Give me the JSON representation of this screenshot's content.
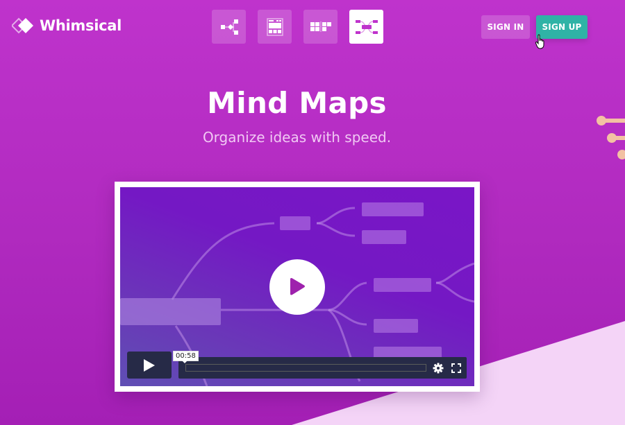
{
  "brand": {
    "name": "Whimsical"
  },
  "switcher": {
    "items": [
      {
        "name": "flowcharts",
        "icon": "flowchart-icon",
        "active": false
      },
      {
        "name": "wireframes",
        "icon": "wireframe-icon",
        "active": false
      },
      {
        "name": "sticky-notes",
        "icon": "sticky-notes-icon",
        "active": false
      },
      {
        "name": "mind-maps",
        "icon": "mind-map-icon",
        "active": true
      }
    ]
  },
  "auth": {
    "sign_in": "SIGN IN",
    "sign_up": "SIGN UP"
  },
  "hero": {
    "title": "Mind Maps",
    "subtitle": "Organize ideas with speed."
  },
  "video": {
    "time_tooltip": "00:58",
    "progress": 0,
    "controls": [
      "play-icon",
      "settings-icon",
      "fullscreen-icon"
    ]
  },
  "colors": {
    "background": "#bf33cc",
    "sign_up": "#2fb3a6",
    "video_controls": "#262a47",
    "accent_light": "#f4d4f7",
    "deco": "#f3c1a3"
  }
}
